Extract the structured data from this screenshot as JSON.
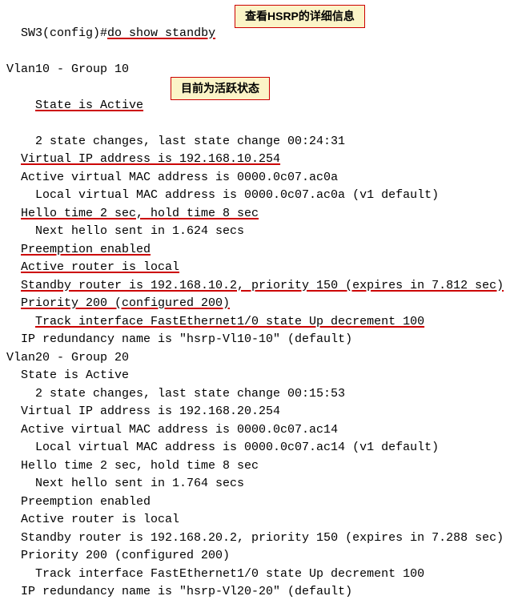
{
  "lines": {
    "l0_pre": "SW3(config)#",
    "l0_cmd": "do show standby",
    "annotation1": "查看HSRP的详细信息",
    "l1": "Vlan10 - Group 10",
    "l2": "State is Active",
    "annotation2": "目前为活跃状态",
    "l3": "2 state changes, last state change 00:24:31",
    "l4": "Virtual IP address is 192.168.10.254",
    "l5": "Active virtual MAC address is 0000.0c07.ac0a",
    "l6": "Local virtual MAC address is 0000.0c07.ac0a (v1 default)",
    "l7": "Hello time 2 sec, hold time 8 sec",
    "l8": "Next hello sent in 1.624 secs",
    "l9": "Preemption enabled",
    "l10": "Active router is local",
    "l11": "Standby router is 192.168.10.2, priority 150 (expires in 7.812 sec)",
    "l12": "Priority 200 (configured 200)",
    "l13": "Track interface FastEthernet1/0 state Up decrement 100",
    "l14": "IP redundancy name is \"hsrp-Vl10-10\" (default)",
    "l15": "Vlan20 - Group 20",
    "l16": "State is Active",
    "l17": "2 state changes, last state change 00:15:53",
    "l18": "Virtual IP address is 192.168.20.254",
    "l19": "Active virtual MAC address is 0000.0c07.ac14",
    "l20": "Local virtual MAC address is 0000.0c07.ac14 (v1 default)",
    "l21": "Hello time 2 sec, hold time 8 sec",
    "l22": "Next hello sent in 1.764 secs",
    "l23": "Preemption enabled",
    "l24": "Active router is local",
    "l25": "Standby router is 192.168.20.2, priority 150 (expires in 7.288 sec)",
    "l26": "Priority 200 (configured 200)",
    "l27": "Track interface FastEthernet1/0 state Up decrement 100",
    "l28": "IP redundancy name is \"hsrp-Vl20-20\" (default)"
  }
}
